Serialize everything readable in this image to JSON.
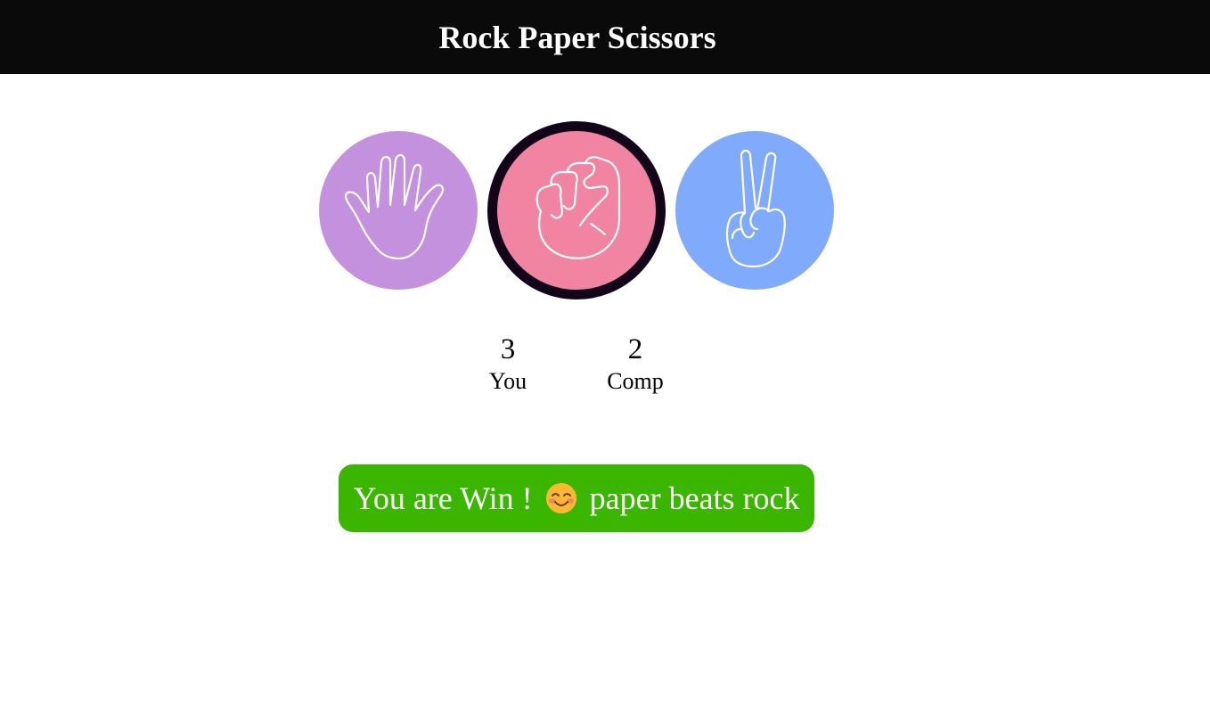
{
  "header": {
    "title": "Rock Paper Scissors"
  },
  "choices": [
    {
      "id": "paper",
      "color": "#c391de",
      "icon": "open-hand-icon"
    },
    {
      "id": "rock",
      "color": "#f084a1",
      "icon": "fist-icon",
      "selected": true
    },
    {
      "id": "scissors",
      "color": "#80abfc",
      "icon": "peace-hand-icon"
    }
  ],
  "scoreboard": {
    "user": {
      "score": "3",
      "label": "You"
    },
    "computer": {
      "score": "2",
      "label": "Comp"
    }
  },
  "message": {
    "prefix": "You are Win !",
    "emoji_icon": "smiling-face-icon",
    "suffix": "paper beats rock",
    "color": "#3ab500"
  }
}
